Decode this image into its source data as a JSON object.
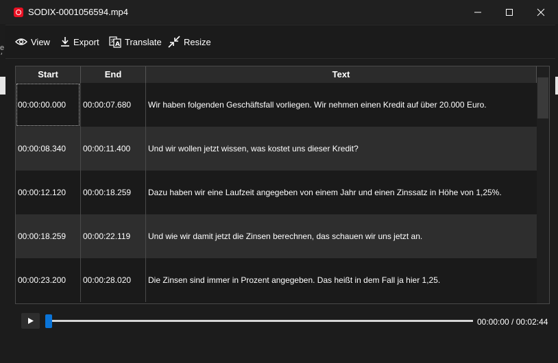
{
  "window": {
    "title": "SODIX-0001056594.mp4"
  },
  "toolbar": {
    "view_label": "View",
    "export_label": "Export",
    "translate_label": "Translate",
    "resize_label": "Resize"
  },
  "table": {
    "columns": [
      "Start",
      "End",
      "Text"
    ],
    "rows": [
      {
        "start": "00:00:00.000",
        "end": "00:00:07.680",
        "text": "Wir haben folgenden Geschäftsfall vorliegen. Wir nehmen einen Kredit auf über 20.000 Euro."
      },
      {
        "start": "00:00:08.340",
        "end": "00:00:11.400",
        "text": "Und wir wollen jetzt wissen, was kostet uns dieser Kredit?"
      },
      {
        "start": "00:00:12.120",
        "end": "00:00:18.259",
        "text": "Dazu haben wir eine Laufzeit angegeben von einem Jahr und einen Zinssatz in Höhe von 1,25%."
      },
      {
        "start": "00:00:18.259",
        "end": "00:00:22.119",
        "text": "Und wie wir damit jetzt die Zinsen berechnen, das schauen wir uns jetzt an."
      },
      {
        "start": "00:00:23.200",
        "end": "00:00:28.020",
        "text": "Die Zinsen sind immer in Prozent angegeben. Das heißt in dem Fall ja hier 1,25."
      }
    ]
  },
  "player": {
    "time_display": "00:00:00 / 00:02:44",
    "progress": 0.0
  },
  "colors": {
    "accent": "#0a74d8",
    "app_icon": "#e81123"
  },
  "left_fragment": "e /"
}
